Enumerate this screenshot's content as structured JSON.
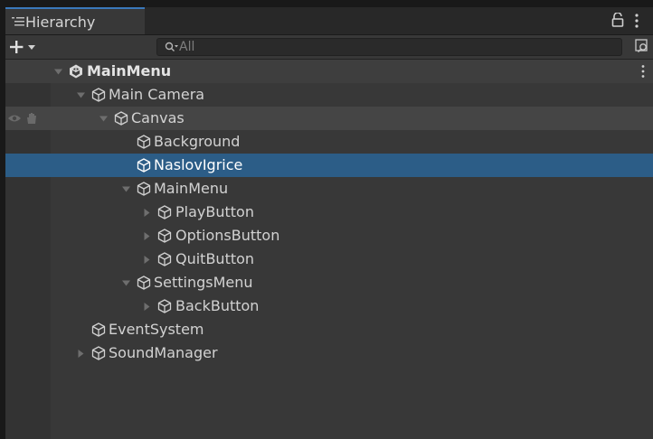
{
  "window": {
    "tab_label": "Hierarchy",
    "tab_icon": "list-icon",
    "lock_icon": "lock-icon",
    "menu_icon": "kebab-menu-icon"
  },
  "toolbar": {
    "add_icon": "plus-dropdown-icon",
    "search_icon": "search-icon",
    "search_placeholder": "All",
    "search_value": "",
    "scene_search_icon": "scene-search-icon"
  },
  "colors": {
    "selection": "#2c5d87",
    "tab_accent": "#3a79bb",
    "panel": "#383838"
  },
  "tree": {
    "scene": {
      "label": "MainMenu",
      "icon": "unity-scene-icon",
      "expanded": true
    },
    "items": [
      {
        "label": "Main Camera",
        "depth": 1,
        "arrow": "expanded",
        "icon": "cube-icon"
      },
      {
        "label": "Canvas",
        "depth": 2,
        "arrow": "expanded",
        "icon": "cube-icon",
        "visibility_icons": [
          "eye-icon",
          "hand-icon"
        ]
      },
      {
        "label": "Background",
        "depth": 3,
        "arrow": "none",
        "icon": "cube-icon"
      },
      {
        "label": "NaslovIgrice",
        "depth": 3,
        "arrow": "none",
        "icon": "cube-icon",
        "selected": true
      },
      {
        "label": "MainMenu",
        "depth": 3,
        "arrow": "expanded",
        "icon": "cube-icon"
      },
      {
        "label": "PlayButton",
        "depth": 4,
        "arrow": "collapsed",
        "icon": "cube-icon"
      },
      {
        "label": "OptionsButton",
        "depth": 4,
        "arrow": "collapsed",
        "icon": "cube-icon"
      },
      {
        "label": "QuitButton",
        "depth": 4,
        "arrow": "collapsed",
        "icon": "cube-icon"
      },
      {
        "label": "SettingsMenu",
        "depth": 3,
        "arrow": "expanded",
        "icon": "cube-icon"
      },
      {
        "label": "BackButton",
        "depth": 4,
        "arrow": "collapsed",
        "icon": "cube-icon"
      },
      {
        "label": "EventSystem",
        "depth": 1,
        "arrow": "none",
        "icon": "cube-icon"
      },
      {
        "label": "SoundManager",
        "depth": 1,
        "arrow": "collapsed",
        "icon": "cube-icon"
      }
    ]
  }
}
